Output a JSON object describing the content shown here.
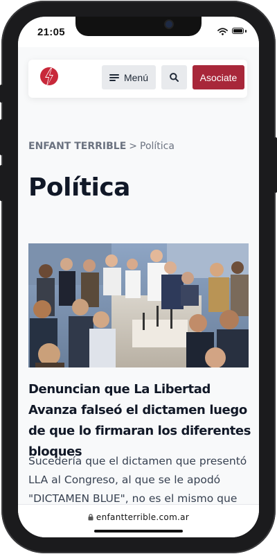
{
  "status_bar": {
    "time": "21:05"
  },
  "header": {
    "logo_icon": "bolt-logo-icon",
    "menu_label": "Menú",
    "search_icon": "search-icon",
    "join_label": "Asociate",
    "colors": {
      "accent": "#a8273a",
      "button_bg": "#e8eaed"
    }
  },
  "breadcrumb": {
    "home": "ENFANT TERRIBLE",
    "separator": ">",
    "current": "Política"
  },
  "page": {
    "title": "Política"
  },
  "article": {
    "title": "Denuncian que La Libertad Avanza falseó el dictamen luego de que lo firmaran los diferentes bloques",
    "excerpt": "Sucedería que el dictamen que presentó LLA al Congreso, al que se le apodó \"DICTAMEN BLUE\", no es el mismo que"
  },
  "browser": {
    "url": "enfantterrible.com.ar"
  }
}
